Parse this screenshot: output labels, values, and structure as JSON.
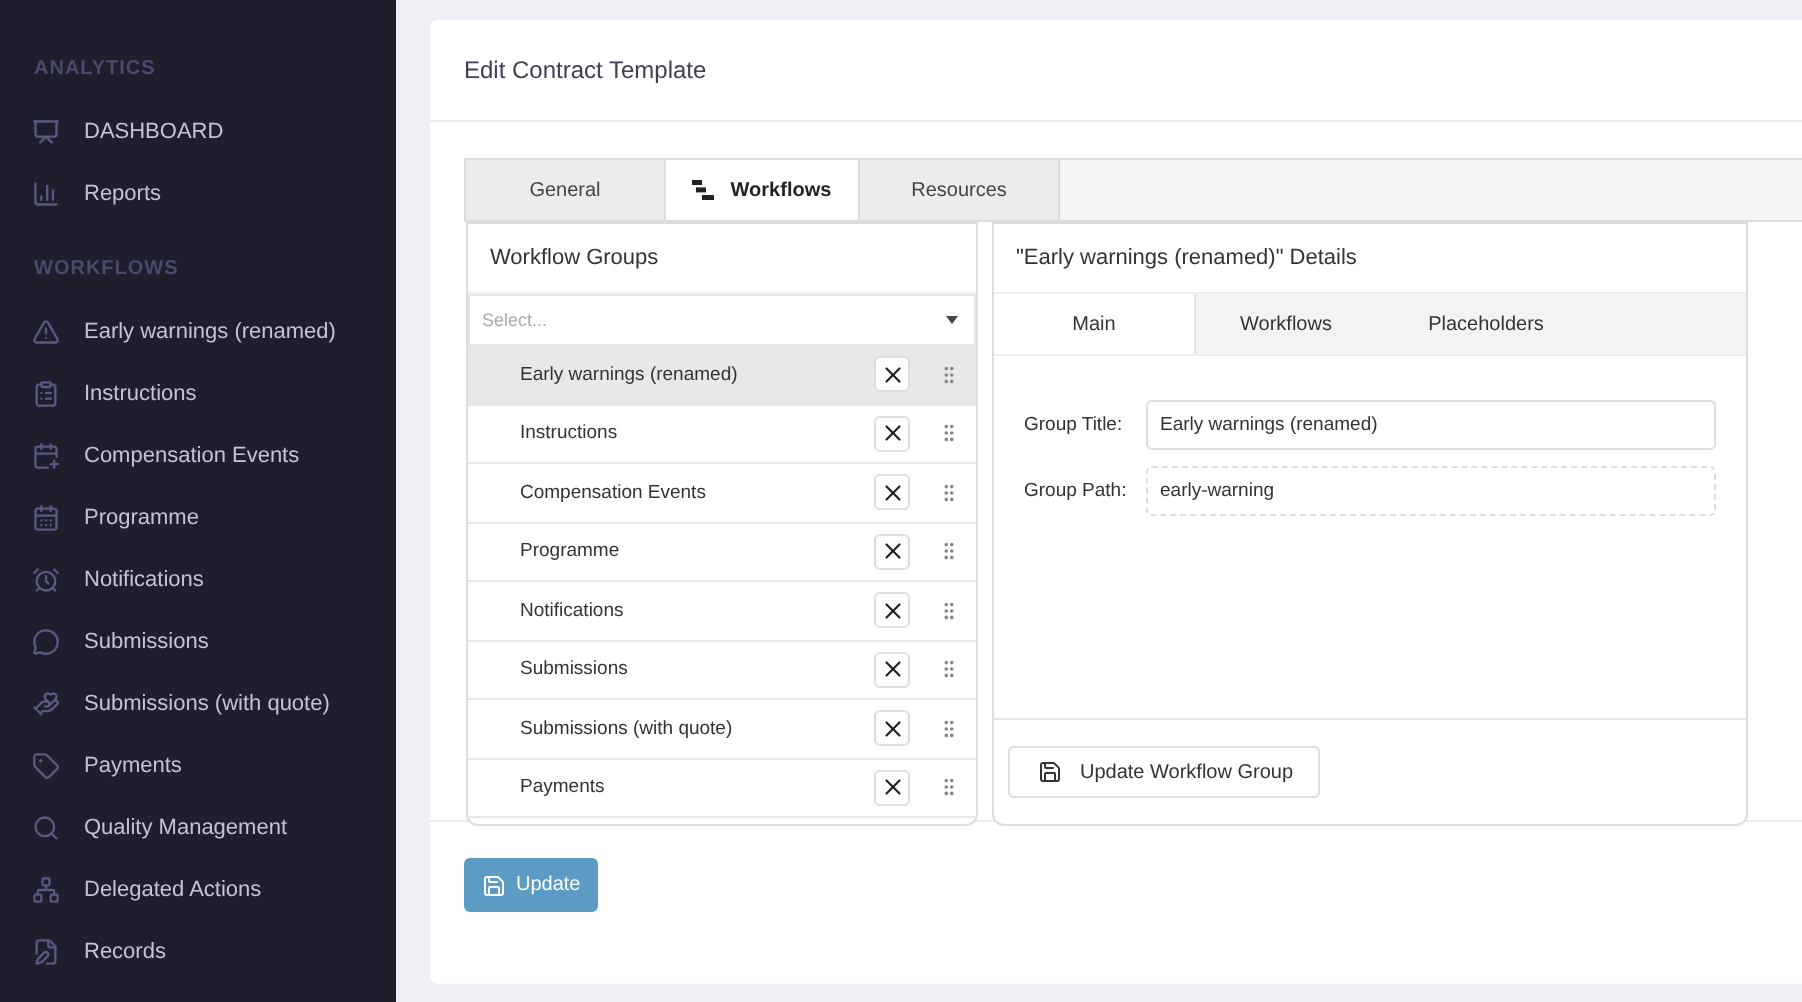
{
  "sidebar": {
    "sections": [
      {
        "heading": "ANALYTICS",
        "items": [
          {
            "label": "DASHBOARD",
            "selected": false
          },
          {
            "label": "Reports",
            "selected": false
          }
        ]
      },
      {
        "heading": "WORKFLOWS",
        "items": [
          {
            "label": "Early warnings (renamed)",
            "selected": false
          },
          {
            "label": "Instructions",
            "selected": false
          },
          {
            "label": "Compensation Events",
            "selected": false
          },
          {
            "label": "Programme",
            "selected": false
          },
          {
            "label": "Notifications",
            "selected": false
          },
          {
            "label": "Submissions",
            "selected": false
          },
          {
            "label": "Submissions (with quote)",
            "selected": false
          },
          {
            "label": "Payments",
            "selected": false
          },
          {
            "label": "Quality Management",
            "selected": false
          },
          {
            "label": "Delegated Actions",
            "selected": false
          },
          {
            "label": "Records",
            "selected": false
          }
        ]
      }
    ]
  },
  "page": {
    "title": "Edit Contract Template"
  },
  "tabs": [
    {
      "label": "General",
      "selected": false
    },
    {
      "label": "Workflows",
      "selected": true
    },
    {
      "label": "Resources",
      "selected": false
    }
  ],
  "workflow_groups": {
    "title": "Workflow Groups",
    "select": {
      "placeholder": "Select..."
    },
    "items": [
      {
        "label": "Early warnings (renamed)",
        "selected": true
      },
      {
        "label": "Instructions",
        "selected": false
      },
      {
        "label": "Compensation Events",
        "selected": false
      },
      {
        "label": "Programme",
        "selected": false
      },
      {
        "label": "Notifications",
        "selected": false
      },
      {
        "label": "Submissions",
        "selected": false
      },
      {
        "label": "Submissions (with quote)",
        "selected": false
      },
      {
        "label": "Payments",
        "selected": false
      }
    ]
  },
  "details": {
    "title": "\"Early warnings (renamed)\" Details",
    "tabs": [
      {
        "label": "Main",
        "selected": true
      },
      {
        "label": "Workflows",
        "selected": false
      },
      {
        "label": "Placeholders",
        "selected": false
      }
    ],
    "fields": [
      {
        "label": "Group Title:",
        "value": "Early warnings (renamed)",
        "readonly": false
      },
      {
        "label": "Group Path:",
        "value": "early-warning",
        "readonly": true
      }
    ],
    "button": "Update Workflow Group"
  },
  "footer": {
    "button": "Update"
  }
}
